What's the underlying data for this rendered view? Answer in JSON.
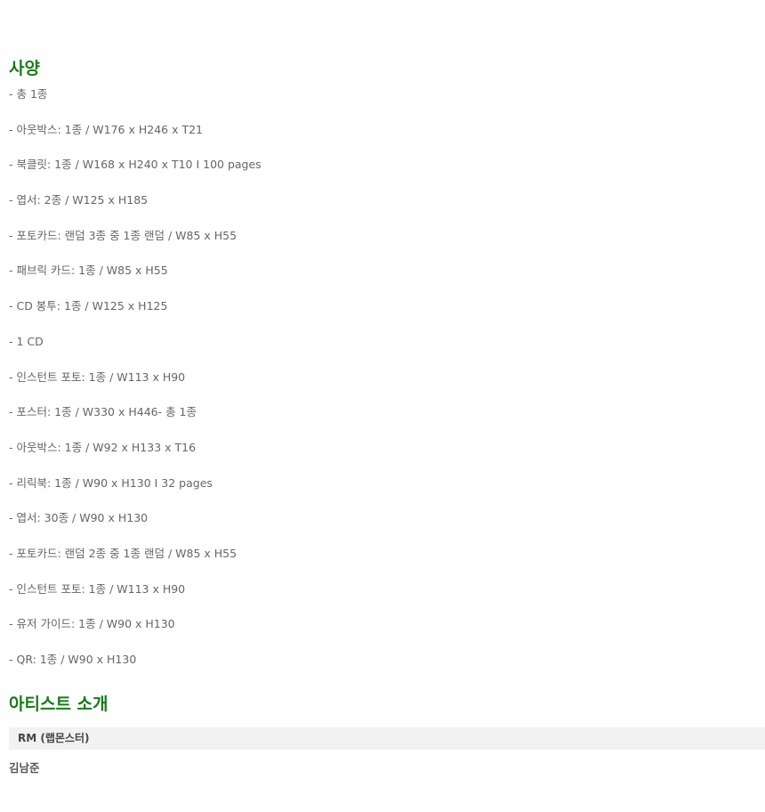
{
  "spec": {
    "title": "사양",
    "items": [
      "- 총 1종",
      "- 아웃박스: 1종 / W176 x H246 x T21",
      "- 북클릿: 1종 / W168 x H240 x T10 I 100 pages",
      "- 엽서: 2종 / W125 x H185",
      "- 포토카드: 랜덤 3종 중 1종 랜덤 / W85 x H55",
      "- 패브릭 카드: 1종 / W85 x H55",
      "- CD 봉투: 1종 / W125 x H125",
      "- 1 CD",
      "- 인스턴트 포토: 1종 / W113 x H90",
      "- 포스터: 1종 / W330 x H446- 총 1종",
      "- 아웃박스: 1종 / W92 x H133 x T16",
      "- 리릭북: 1종 / W90 x H130 I 32 pages",
      "- 엽서: 30종 / W90 x H130",
      "- 포토카드: 랜덤 2종 중 1종 랜덤 / W85 x H55",
      "- 인스턴트 포토: 1종 / W113 x H90",
      "- 유저 가이드: 1종 / W90 x H130",
      "- QR: 1종 / W90 x H130"
    ]
  },
  "artist": {
    "title": "아티스트 소개",
    "bar_label": "RM (랩몬스터)",
    "name": "김남준"
  },
  "colors": {
    "heading": "#1a7a1a",
    "body_text": "#666666",
    "bar_background": "#f2f2f2"
  }
}
